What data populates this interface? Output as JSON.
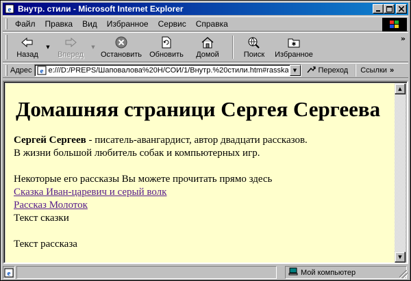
{
  "window": {
    "title": "Внутр. стили - Microsoft Internet Explorer"
  },
  "menu": {
    "items": [
      "Файл",
      "Правка",
      "Вид",
      "Избранное",
      "Сервис",
      "Справка"
    ]
  },
  "toolbar": {
    "back": "Назад",
    "forward": "Вперед",
    "stop": "Остановить",
    "refresh": "Обновить",
    "home": "Домой",
    "search": "Поиск",
    "favorites": "Избранное"
  },
  "address": {
    "label": "Адрес",
    "url": "e:///D:/PREPS/Шаповалова%20Н/СОИ/1/Внутр.%20стили.htm#rasskaz",
    "go_label": "Переход",
    "links_label": "Ссылки"
  },
  "page": {
    "heading": "Домашняя страници Сергея Сергеева",
    "author_name": "Сергей Сергеев",
    "intro_line1": " - писатель-авангардист, автор двадцати рассказов.",
    "intro_line2": "В жизни большой любитель собак и компьютерных игр.",
    "stories_intro": "Некоторые его рассказы Вы можете прочитать прямо здесь",
    "link1": "Сказка Иван-царевич и серый волк",
    "link2": "Рассказ Молоток",
    "tale_text": "Текст сказки",
    "story_text": "Текст рассказа"
  },
  "status": {
    "zone": "Мой компьютер"
  },
  "colors": {
    "title_bar": "#000080",
    "page_background": "#ffffcc",
    "link_visited": "#551a8b"
  }
}
